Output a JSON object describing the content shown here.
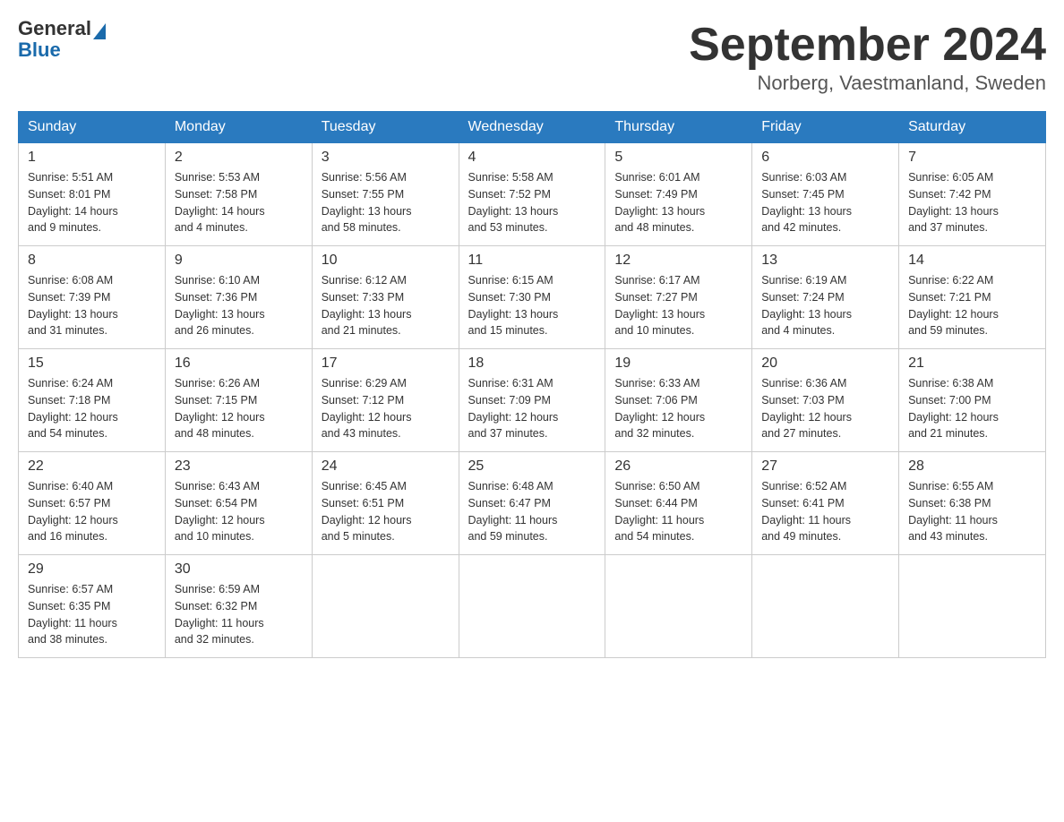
{
  "header": {
    "title": "September 2024",
    "location": "Norberg, Vaestmanland, Sweden",
    "logo_general": "General",
    "logo_blue": "Blue"
  },
  "days_of_week": [
    "Sunday",
    "Monday",
    "Tuesday",
    "Wednesday",
    "Thursday",
    "Friday",
    "Saturday"
  ],
  "weeks": [
    [
      {
        "day": "1",
        "sunrise": "5:51 AM",
        "sunset": "8:01 PM",
        "daylight": "14 hours and 9 minutes."
      },
      {
        "day": "2",
        "sunrise": "5:53 AM",
        "sunset": "7:58 PM",
        "daylight": "14 hours and 4 minutes."
      },
      {
        "day": "3",
        "sunrise": "5:56 AM",
        "sunset": "7:55 PM",
        "daylight": "13 hours and 58 minutes."
      },
      {
        "day": "4",
        "sunrise": "5:58 AM",
        "sunset": "7:52 PM",
        "daylight": "13 hours and 53 minutes."
      },
      {
        "day": "5",
        "sunrise": "6:01 AM",
        "sunset": "7:49 PM",
        "daylight": "13 hours and 48 minutes."
      },
      {
        "day": "6",
        "sunrise": "6:03 AM",
        "sunset": "7:45 PM",
        "daylight": "13 hours and 42 minutes."
      },
      {
        "day": "7",
        "sunrise": "6:05 AM",
        "sunset": "7:42 PM",
        "daylight": "13 hours and 37 minutes."
      }
    ],
    [
      {
        "day": "8",
        "sunrise": "6:08 AM",
        "sunset": "7:39 PM",
        "daylight": "13 hours and 31 minutes."
      },
      {
        "day": "9",
        "sunrise": "6:10 AM",
        "sunset": "7:36 PM",
        "daylight": "13 hours and 26 minutes."
      },
      {
        "day": "10",
        "sunrise": "6:12 AM",
        "sunset": "7:33 PM",
        "daylight": "13 hours and 21 minutes."
      },
      {
        "day": "11",
        "sunrise": "6:15 AM",
        "sunset": "7:30 PM",
        "daylight": "13 hours and 15 minutes."
      },
      {
        "day": "12",
        "sunrise": "6:17 AM",
        "sunset": "7:27 PM",
        "daylight": "13 hours and 10 minutes."
      },
      {
        "day": "13",
        "sunrise": "6:19 AM",
        "sunset": "7:24 PM",
        "daylight": "13 hours and 4 minutes."
      },
      {
        "day": "14",
        "sunrise": "6:22 AM",
        "sunset": "7:21 PM",
        "daylight": "12 hours and 59 minutes."
      }
    ],
    [
      {
        "day": "15",
        "sunrise": "6:24 AM",
        "sunset": "7:18 PM",
        "daylight": "12 hours and 54 minutes."
      },
      {
        "day": "16",
        "sunrise": "6:26 AM",
        "sunset": "7:15 PM",
        "daylight": "12 hours and 48 minutes."
      },
      {
        "day": "17",
        "sunrise": "6:29 AM",
        "sunset": "7:12 PM",
        "daylight": "12 hours and 43 minutes."
      },
      {
        "day": "18",
        "sunrise": "6:31 AM",
        "sunset": "7:09 PM",
        "daylight": "12 hours and 37 minutes."
      },
      {
        "day": "19",
        "sunrise": "6:33 AM",
        "sunset": "7:06 PM",
        "daylight": "12 hours and 32 minutes."
      },
      {
        "day": "20",
        "sunrise": "6:36 AM",
        "sunset": "7:03 PM",
        "daylight": "12 hours and 27 minutes."
      },
      {
        "day": "21",
        "sunrise": "6:38 AM",
        "sunset": "7:00 PM",
        "daylight": "12 hours and 21 minutes."
      }
    ],
    [
      {
        "day": "22",
        "sunrise": "6:40 AM",
        "sunset": "6:57 PM",
        "daylight": "12 hours and 16 minutes."
      },
      {
        "day": "23",
        "sunrise": "6:43 AM",
        "sunset": "6:54 PM",
        "daylight": "12 hours and 10 minutes."
      },
      {
        "day": "24",
        "sunrise": "6:45 AM",
        "sunset": "6:51 PM",
        "daylight": "12 hours and 5 minutes."
      },
      {
        "day": "25",
        "sunrise": "6:48 AM",
        "sunset": "6:47 PM",
        "daylight": "11 hours and 59 minutes."
      },
      {
        "day": "26",
        "sunrise": "6:50 AM",
        "sunset": "6:44 PM",
        "daylight": "11 hours and 54 minutes."
      },
      {
        "day": "27",
        "sunrise": "6:52 AM",
        "sunset": "6:41 PM",
        "daylight": "11 hours and 49 minutes."
      },
      {
        "day": "28",
        "sunrise": "6:55 AM",
        "sunset": "6:38 PM",
        "daylight": "11 hours and 43 minutes."
      }
    ],
    [
      {
        "day": "29",
        "sunrise": "6:57 AM",
        "sunset": "6:35 PM",
        "daylight": "11 hours and 38 minutes."
      },
      {
        "day": "30",
        "sunrise": "6:59 AM",
        "sunset": "6:32 PM",
        "daylight": "11 hours and 32 minutes."
      },
      null,
      null,
      null,
      null,
      null
    ]
  ]
}
